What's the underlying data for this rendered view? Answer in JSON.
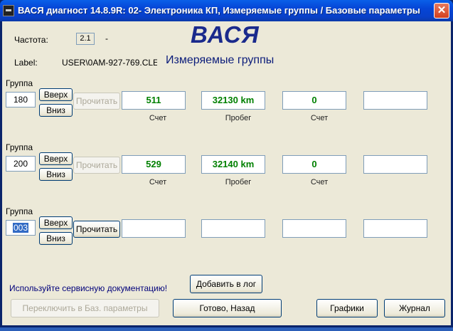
{
  "window": {
    "title": "ВАСЯ диагност 14.8.9R: 02- Электроника КП,  Измеряемые группы / Базовые параметры",
    "close_glyph": "✕"
  },
  "header": {
    "freq_label": "Частота:",
    "freq_value": "2.1",
    "freq_dash": "-",
    "app_name": "ВАСЯ",
    "label_caption": "Label:",
    "label_value": "USER\\0AM-927-769.CLE",
    "section_title": "Измеряемые группы"
  },
  "groups": [
    {
      "caption": "Группа",
      "number": "180",
      "up": "Вверх",
      "down": "Вниз",
      "read": "Прочитать",
      "read_enabled": false,
      "fields": [
        {
          "value": "511",
          "unit": "Счет"
        },
        {
          "value": "32130 km",
          "unit": "Пробег"
        },
        {
          "value": "0",
          "unit": "Счет"
        },
        {
          "value": "",
          "unit": ""
        }
      ]
    },
    {
      "caption": "Группа",
      "number": "200",
      "up": "Вверх",
      "down": "Вниз",
      "read": "Прочитать",
      "read_enabled": false,
      "fields": [
        {
          "value": "529",
          "unit": "Счет"
        },
        {
          "value": "32140 km",
          "unit": "Пробег"
        },
        {
          "value": "0",
          "unit": "Счет"
        },
        {
          "value": "",
          "unit": ""
        }
      ]
    },
    {
      "caption": "Группа",
      "number": "003",
      "up": "Вверх",
      "down": "Вниз",
      "read": "Прочитать",
      "read_enabled": true,
      "fields": [
        {
          "value": "",
          "unit": ""
        },
        {
          "value": "",
          "unit": ""
        },
        {
          "value": "",
          "unit": ""
        },
        {
          "value": "",
          "unit": ""
        }
      ]
    }
  ],
  "footer": {
    "hint": "Используйте сервисную документацию!",
    "add_log": "Добавить в лог",
    "switch_basic": "Переключить в Баз. параметры",
    "done_back": "Готово, Назад",
    "graphs": "Графики",
    "journal": "Журнал"
  },
  "colors": {
    "title_bar": "#0545d6",
    "value_text": "#008000",
    "app_name": "#1a2a8c"
  }
}
